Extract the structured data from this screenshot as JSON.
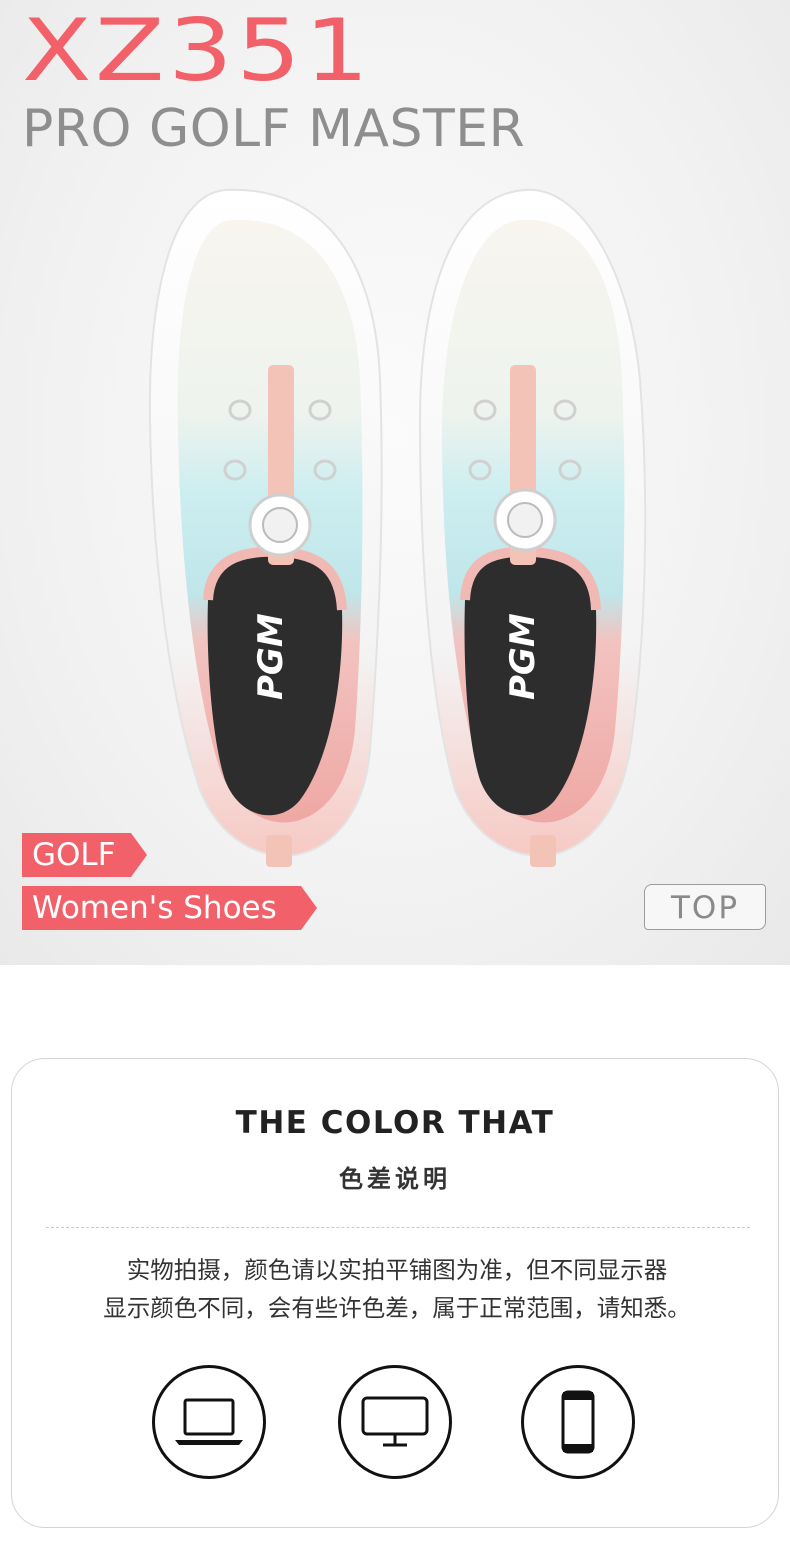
{
  "hero": {
    "model": "XZ351",
    "series": "PRO GOLF MASTER",
    "tag_golf": "GOLF",
    "tag_women": "Women's Shoes",
    "top_label": "TOP",
    "brand_mark": "PGM",
    "accent_color": "#f2616a"
  },
  "color_notice": {
    "title": "THE COLOR THAT",
    "subtitle": "色差说明",
    "line1": "实物拍摄，颜色请以实拍平铺图为准，但不同显示器",
    "line2": "显示颜色不同，会有些许色差，属于正常范围，请知悉。",
    "devices": [
      "laptop-icon",
      "monitor-icon",
      "phone-icon"
    ]
  }
}
